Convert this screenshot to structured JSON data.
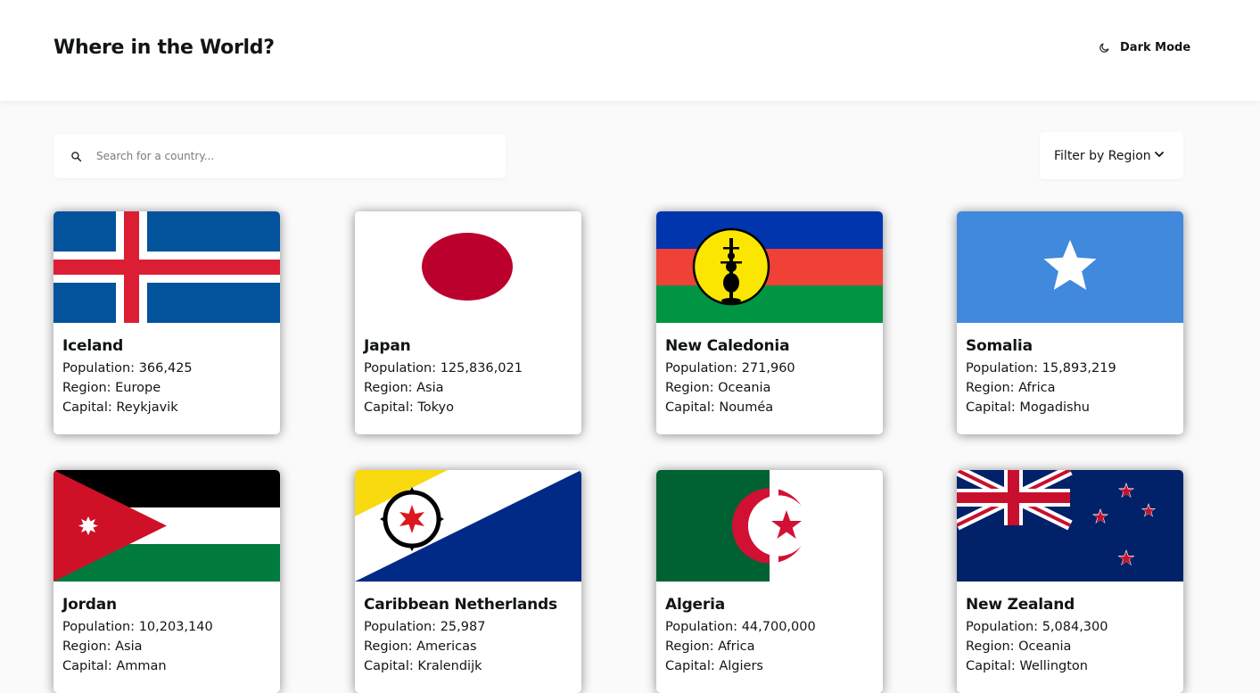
{
  "header": {
    "title": "Where in the World?",
    "dark_mode_label": "Dark Mode",
    "dark_mode_icon": "moon-icon"
  },
  "search": {
    "placeholder": "Search for a country...",
    "value": "",
    "icon": "search-icon"
  },
  "filter": {
    "label": "Filter by Region",
    "icon": "chevron-down-icon"
  },
  "labels": {
    "population": "Population:",
    "region": "Region:",
    "capital": "Capital:"
  },
  "countries": [
    {
      "name": "Iceland",
      "population": "366,425",
      "region": "Europe",
      "capital": "Reykjavik",
      "flag": "iceland-flag"
    },
    {
      "name": "Japan",
      "population": "125,836,021",
      "region": "Asia",
      "capital": "Tokyo",
      "flag": "japan-flag"
    },
    {
      "name": "New Caledonia",
      "population": "271,960",
      "region": "Oceania",
      "capital": "Nouméa",
      "flag": "new-caledonia-flag"
    },
    {
      "name": "Somalia",
      "population": "15,893,219",
      "region": "Africa",
      "capital": "Mogadishu",
      "flag": "somalia-flag"
    },
    {
      "name": "Jordan",
      "population": "10,203,140",
      "region": "Asia",
      "capital": "Amman",
      "flag": "jordan-flag"
    },
    {
      "name": "Caribbean Netherlands",
      "population": "25,987",
      "region": "Americas",
      "capital": "Kralendijk",
      "flag": "caribbean-netherlands-flag"
    },
    {
      "name": "Algeria",
      "population": "44,700,000",
      "region": "Africa",
      "capital": "Algiers",
      "flag": "algeria-flag"
    },
    {
      "name": "New Zealand",
      "population": "5,084,300",
      "region": "Oceania",
      "capital": "Wellington",
      "flag": "new-zealand-flag"
    }
  ],
  "colors": {
    "background": "#fafafa",
    "element": "#ffffff",
    "text": "#111517",
    "placeholder": "#7b7b7b"
  }
}
